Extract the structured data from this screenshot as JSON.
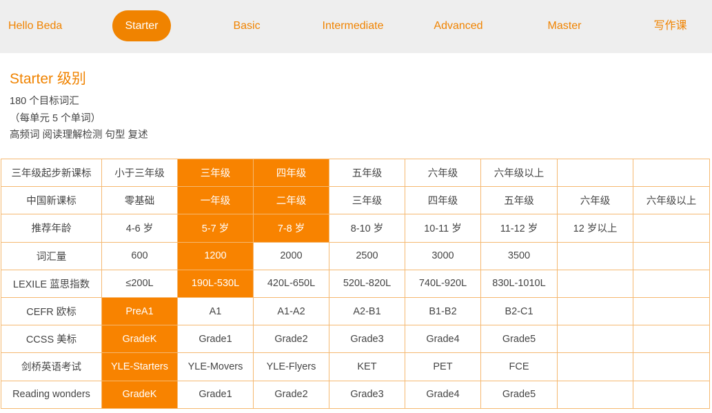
{
  "nav": {
    "items": [
      {
        "label": "Hello Beda",
        "active": false
      },
      {
        "label": "Starter",
        "active": true
      },
      {
        "label": "Basic",
        "active": false
      },
      {
        "label": "Intermediate",
        "active": false
      },
      {
        "label": "Advanced",
        "active": false
      },
      {
        "label": "Master",
        "active": false
      },
      {
        "label": "写作课",
        "active": false
      }
    ]
  },
  "info": {
    "title": "Starter 级别",
    "lines": [
      "180 个目标词汇",
      "（每单元 5 个单词）",
      "高频词 阅读理解检测 句型 复述"
    ]
  },
  "colors": {
    "accent": "#f08300",
    "highlight": "#f88300",
    "nav_bg": "#eeeeee",
    "border": "#f5b870"
  },
  "table": {
    "rows": [
      {
        "cells": [
          "三年级起步新课标",
          "小于三年级",
          "三年级",
          "四年级",
          "五年级",
          "六年级",
          "六年级以上",
          "",
          ""
        ],
        "highlight": [
          2,
          3
        ]
      },
      {
        "cells": [
          "中国新课标",
          "零基础",
          "一年级",
          "二年级",
          "三年级",
          "四年级",
          "五年级",
          "六年级",
          "六年级以上"
        ],
        "highlight": [
          2,
          3
        ]
      },
      {
        "cells": [
          "推荐年龄",
          "4-6 岁",
          "5-7 岁",
          "7-8 岁",
          "8-10 岁",
          "10-11 岁",
          "11-12 岁",
          "12 岁以上",
          ""
        ],
        "highlight": [
          2,
          3
        ]
      },
      {
        "cells": [
          "词汇量",
          "600",
          "1200",
          "2000",
          "2500",
          "3000",
          "3500",
          "",
          ""
        ],
        "highlight": [
          2
        ]
      },
      {
        "cells": [
          "LEXILE 蓝思指数",
          "≤200L",
          "190L-530L",
          "420L-650L",
          "520L-820L",
          "740L-920L",
          "830L-1010L",
          "",
          ""
        ],
        "highlight": [
          2
        ]
      },
      {
        "cells": [
          "CEFR 欧标",
          "PreA1",
          "A1",
          "A1-A2",
          "A2-B1",
          "B1-B2",
          "B2-C1",
          "",
          ""
        ],
        "highlight": [
          1
        ]
      },
      {
        "cells": [
          "CCSS 美标",
          "GradeK",
          "Grade1",
          "Grade2",
          "Grade3",
          "Grade4",
          "Grade5",
          "",
          ""
        ],
        "highlight": [
          1
        ]
      },
      {
        "cells": [
          "剑桥英语考试",
          "YLE-Starters",
          "YLE-Movers",
          "YLE-Flyers",
          "KET",
          "PET",
          "FCE",
          "",
          ""
        ],
        "highlight": [
          1
        ]
      },
      {
        "cells": [
          "Reading wonders",
          "GradeK",
          "Grade1",
          "Grade2",
          "Grade3",
          "Grade4",
          "Grade5",
          "",
          ""
        ],
        "highlight": [
          1
        ]
      }
    ]
  }
}
